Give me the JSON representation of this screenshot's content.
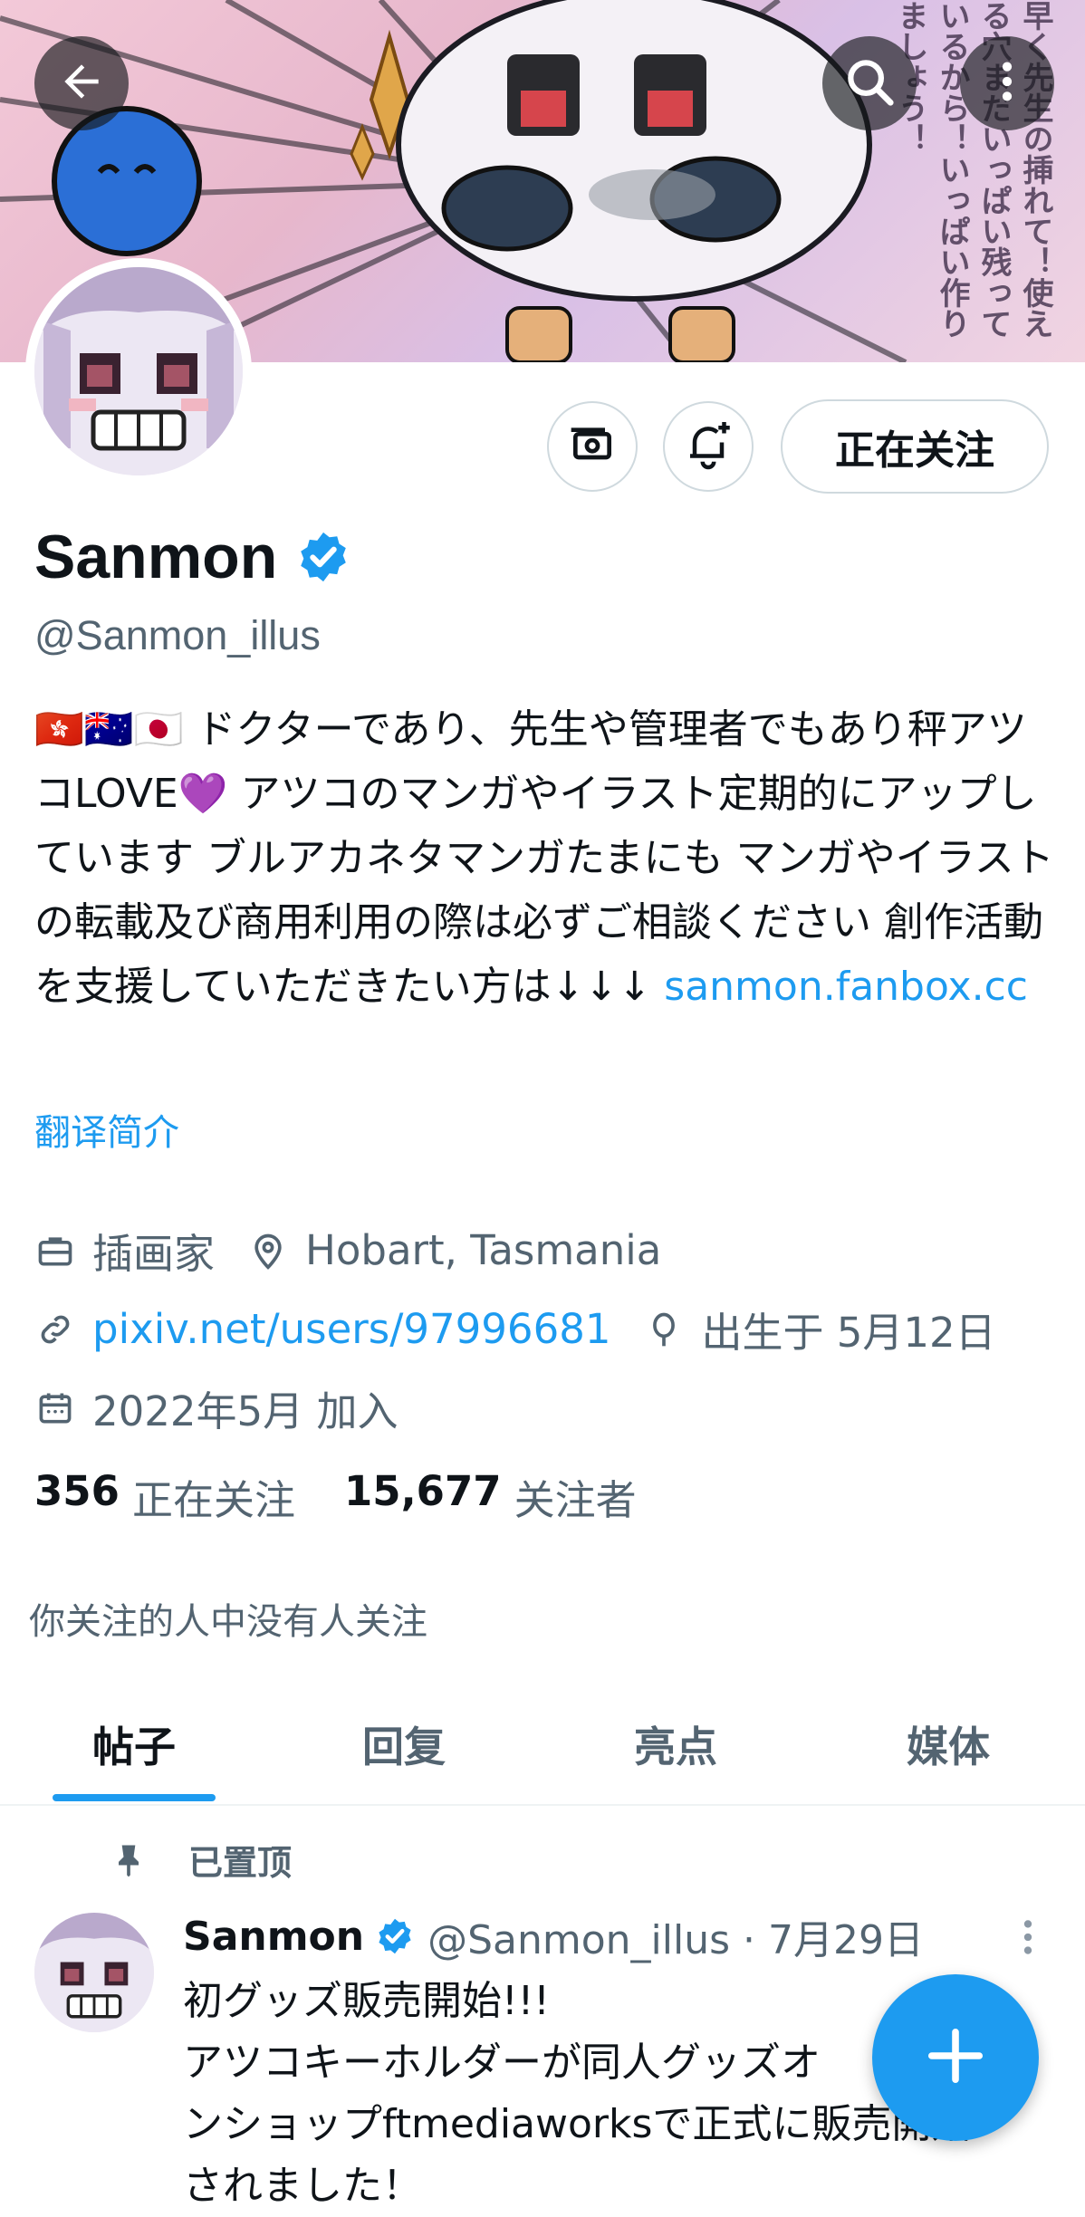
{
  "header": {
    "banner_text": "早く先生の挿れて！使える穴まだいっぱい残っているから！いっぱい作りましょう！",
    "back_icon": "arrow-left-icon",
    "search_icon": "search-icon",
    "more_icon": "more-vertical-icon"
  },
  "profile": {
    "name": "Sanmon",
    "handle": "@Sanmon_illus",
    "verified": true,
    "follow_label": "正在关注",
    "bio_flags": "🇭🇰🇦🇺🇯🇵",
    "bio_text": " ドクターであり、先生や管理者でもあり秤アツコLOVE💜 アツコのマンガやイラスト定期的にアップしています ブルアカネタマンガたまにも マンガやイラストの転載及び商用利用の際は必ずご相談ください 創作活動を支援していただきたい方は↓↓↓ ",
    "bio_link": "sanmon.fanbox.cc",
    "translate_label": "翻译简介",
    "profession": "插画家",
    "location": "Hobart, Tasmania",
    "website": "pixiv.net/users/97996681",
    "birthday": "出生于 5月12日",
    "joined": "2022年5月 加入",
    "following_count": "356",
    "following_label": "正在关注",
    "followers_count": "15,677",
    "followers_label": "关注者",
    "followers_note": "你关注的人中没有人关注"
  },
  "tabs": [
    {
      "label": "帖子",
      "active": true
    },
    {
      "label": "回复",
      "active": false
    },
    {
      "label": "亮点",
      "active": false
    },
    {
      "label": "媒体",
      "active": false
    }
  ],
  "pinned_post": {
    "pinned_label": "已置顶",
    "author": "Sanmon",
    "handle_date": "@Sanmon_illus · 7月29日",
    "body_lines": [
      "初グッズ販売開始!!!",
      "アツコキーホルダーが同人グッズオ",
      "ンショップftmediaworksで正式に販売開始",
      "されました！"
    ]
  },
  "colors": {
    "accent": "#1d9bf0",
    "secondary_text": "#536471",
    "border": "#cfd9de"
  }
}
